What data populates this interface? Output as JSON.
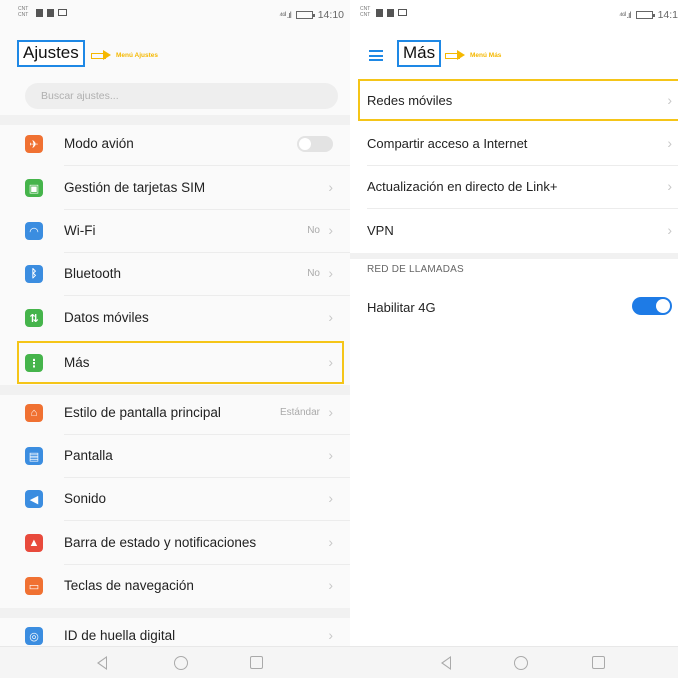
{
  "status_bar": {
    "carrier_1": "CNT",
    "carrier_2": "CNT",
    "signal": "⁴⁶ᴵ .ıl",
    "time_left": "14:10",
    "time_right": "14:1"
  },
  "left_screen": {
    "title": "Ajustes",
    "annotation": "Menú Ajustes",
    "search_placeholder": "Buscar ajustes...",
    "items": [
      {
        "label": "Modo avión",
        "icon": "airplane-icon",
        "color": "#f07132",
        "control": "toggle-off"
      },
      {
        "label": "Gestión de tarjetas SIM",
        "icon": "sim-card-icon",
        "color": "#45b44b"
      },
      {
        "label": "Wi-Fi",
        "icon": "wifi-icon",
        "color": "#3b8de0",
        "value": "No"
      },
      {
        "label": "Bluetooth",
        "icon": "bluetooth-icon",
        "color": "#3b8de0",
        "value": "No"
      },
      {
        "label": "Datos móviles",
        "icon": "mobile-data-icon",
        "color": "#45b44b"
      },
      {
        "label": "Más",
        "icon": "more-icon",
        "color": "#45b44b"
      },
      {
        "label": "Estilo de pantalla principal",
        "icon": "home-style-icon",
        "color": "#f07132",
        "value": "Estándar"
      },
      {
        "label": "Pantalla",
        "icon": "display-icon",
        "color": "#3b8de0"
      },
      {
        "label": "Sonido",
        "icon": "sound-icon",
        "color": "#3b8de0"
      },
      {
        "label": "Barra de estado y notificaciones",
        "icon": "notification-icon",
        "color": "#e84a3c"
      },
      {
        "label": "Teclas de navegación",
        "icon": "navigation-keys-icon",
        "color": "#f07132"
      },
      {
        "label": "ID de huella digital",
        "icon": "fingerprint-icon",
        "color": "#3b8de0"
      }
    ]
  },
  "right_screen": {
    "title": "Más",
    "annotation": "Menú Más",
    "items": [
      {
        "label": "Redes móviles"
      },
      {
        "label": "Compartir acceso a Internet"
      },
      {
        "label": "Actualización en directo de Link+"
      },
      {
        "label": "VPN"
      }
    ],
    "section_header": "RED DE LLAMADAS",
    "toggle_item": {
      "label": "Habilitar 4G",
      "state": "on"
    }
  },
  "colors": {
    "accent_blue": "#1e88e5",
    "highlight_yellow": "#f5c518"
  }
}
